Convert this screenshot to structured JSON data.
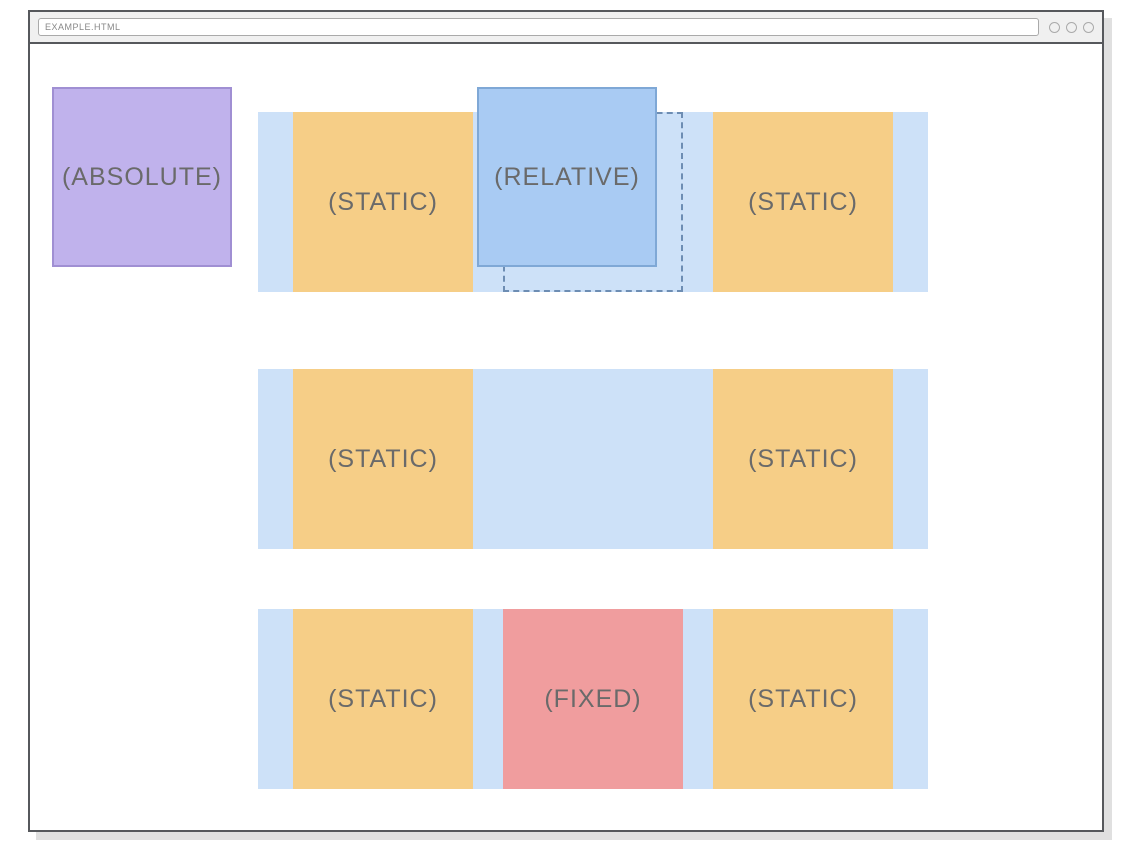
{
  "browser": {
    "address": "EXAMPLE.HTML"
  },
  "labels": {
    "absolute": "(ABSOLUTE)",
    "static": "(STATIC)",
    "relative": "(RELATIVE)",
    "fixed": "(FIXED)"
  },
  "colors": {
    "row_bg": "#cde1f8",
    "static_bg": "#f6ce87",
    "relative_bg": "#a9cbf3",
    "absolute_bg": "#c0b2ec",
    "fixed_bg": "#f09d9e",
    "text": "#6a6a6a",
    "chrome_border": "#56585c"
  },
  "layout": {
    "rows": [
      {
        "boxes": [
          "static",
          "relative_ghost",
          "static"
        ]
      },
      {
        "boxes": [
          "static",
          "gap",
          "static"
        ]
      },
      {
        "boxes": [
          "static",
          "fixed",
          "static"
        ]
      }
    ],
    "floating": [
      "absolute",
      "relative"
    ]
  }
}
